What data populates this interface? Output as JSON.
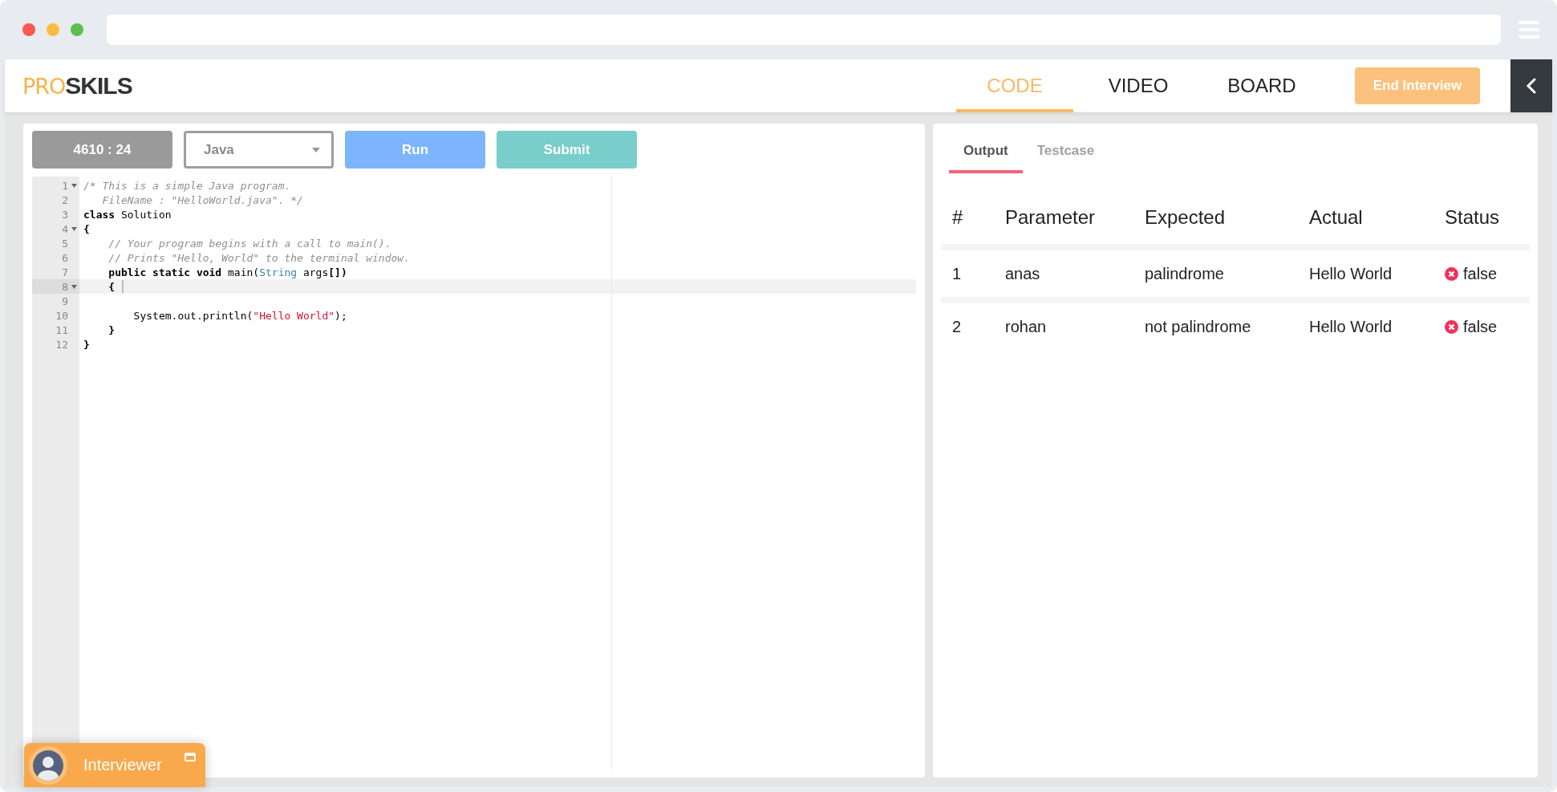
{
  "logo": {
    "light": "PRO",
    "bold": "SKILS"
  },
  "nav_tabs": [
    {
      "label": "CODE",
      "selected": true
    },
    {
      "label": "VIDEO",
      "selected": false
    },
    {
      "label": "BOARD",
      "selected": false
    }
  ],
  "end_button": "End Interview",
  "toolbar": {
    "timer": "4610 : 24",
    "language": "Java",
    "run": "Run",
    "submit": "Submit"
  },
  "code_lines": [
    {
      "number": "1",
      "fold": true,
      "active": false,
      "tokens": [
        {
          "kind": "comment",
          "text": "/* This is a simple Java program."
        }
      ]
    },
    {
      "number": "2",
      "fold": false,
      "active": false,
      "tokens": [
        {
          "kind": "comment",
          "text": "   FileName : \"HelloWorld.java\". */"
        }
      ]
    },
    {
      "number": "3",
      "fold": false,
      "active": false,
      "tokens": [
        {
          "kind": "keyword",
          "text": "class"
        },
        {
          "kind": "plain",
          "text": " Solution"
        }
      ]
    },
    {
      "number": "4",
      "fold": true,
      "active": false,
      "tokens": [
        {
          "kind": "keyword",
          "text": "{"
        }
      ]
    },
    {
      "number": "5",
      "fold": false,
      "active": false,
      "tokens": [
        {
          "kind": "comment",
          "text": "    // Your program begins with a call to main()."
        }
      ]
    },
    {
      "number": "6",
      "fold": false,
      "active": false,
      "tokens": [
        {
          "kind": "comment",
          "text": "    // Prints \"Hello, World\" to the terminal window."
        }
      ]
    },
    {
      "number": "7",
      "fold": false,
      "active": false,
      "tokens": [
        {
          "kind": "keyword",
          "text": "    public static void"
        },
        {
          "kind": "plain",
          "text": " main("
        },
        {
          "kind": "type",
          "text": "String"
        },
        {
          "kind": "plain",
          "text": " args"
        },
        {
          "kind": "keyword",
          "text": "[])"
        }
      ]
    },
    {
      "number": "8",
      "fold": true,
      "active": true,
      "tokens": [
        {
          "kind": "keyword",
          "text": "    {"
        }
      ]
    },
    {
      "number": "9",
      "fold": false,
      "active": false
    },
    {
      "number": "10",
      "fold": false,
      "active": false,
      "tokens": [
        {
          "kind": "plain",
          "text": "        System.out.println("
        },
        {
          "kind": "string",
          "text": "\"Hello World\""
        },
        {
          "kind": "plain",
          "text": ");"
        }
      ]
    },
    {
      "number": "11",
      "fold": false,
      "active": false,
      "tokens": [
        {
          "kind": "keyword",
          "text": "    }"
        }
      ]
    },
    {
      "number": "12",
      "fold": false,
      "active": false,
      "tokens": [
        {
          "kind": "keyword",
          "text": "}"
        }
      ]
    }
  ],
  "output_tabs": [
    {
      "label": "Output",
      "selected": true
    },
    {
      "label": "Testcase",
      "selected": false
    }
  ],
  "results": {
    "columns": [
      "#",
      "Parameter",
      "Expected",
      "Actual",
      "Status"
    ],
    "rows": [
      {
        "index": "1",
        "parameter": "anas",
        "expected": "palindrome",
        "actual": "Hello World",
        "status": "false",
        "passed": false
      },
      {
        "index": "2",
        "parameter": "rohan",
        "expected": "not palindrome",
        "actual": "Hello World",
        "status": "false",
        "passed": false
      }
    ]
  },
  "video_chip": {
    "label": "Interviewer"
  }
}
